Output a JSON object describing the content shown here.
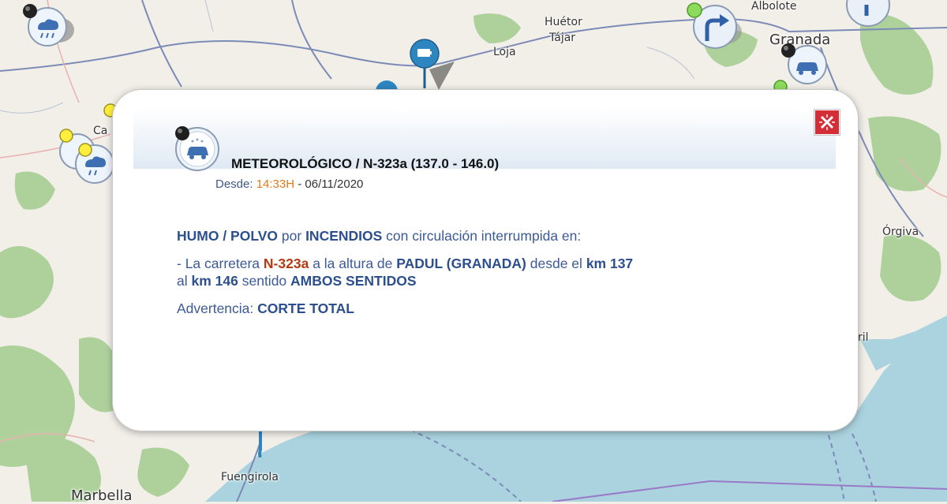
{
  "map": {
    "places": {
      "huetor": "Huétor",
      "tajar": "Tájar",
      "loja": "Loja",
      "albolote": "Albolote",
      "granada": "Granada",
      "orgiva": "Órgiva",
      "fuengirola": "Fuengirola",
      "marbella": "Marbella",
      "cutoff_left": "Ca",
      "cutoff_right": "ril"
    },
    "marker_icons": [
      "weather-car-icon",
      "weather-rain-icon",
      "turn-right-arrow-icon",
      "traffic-camera-icon"
    ],
    "colors": {
      "land": "#f2efe9",
      "sea": "#aad3df",
      "forest": "#aed19c",
      "road": "#7c8ab6",
      "marker_blue": "#2e86c1"
    }
  },
  "popup": {
    "icon": "weather-car-icon",
    "title": "METEOROLÓGICO / N-323a (137.0 - 146.0)",
    "since_label": "Desde:",
    "since_time": "14:33H",
    "since_sep": "-",
    "since_date": "06/11/2020",
    "close_icon": "close-x-icon",
    "body": {
      "line1": {
        "cause": "HUMO / POLVO",
        "por": "por",
        "reason": "INCENDIOS",
        "rest": "con circulación interrumpida en:"
      },
      "line2": {
        "prefix": "- La carretera",
        "road": "N-323a",
        "altura": "a la altura de",
        "place": "PADUL (GRANADA)",
        "desde": "desde el",
        "km_from": "km 137",
        "al": "al",
        "km_to": "km 146",
        "sentido": "sentido",
        "direction": "AMBOS SENTIDOS"
      },
      "line3": {
        "label": "Advertencia:",
        "value": "CORTE TOTAL"
      }
    }
  }
}
